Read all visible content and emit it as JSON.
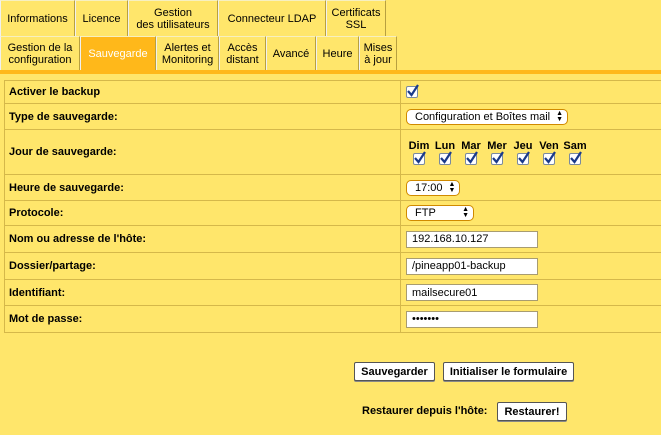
{
  "tabs_row1": [
    {
      "name": "tab-informations",
      "label": "Informations",
      "width": 75
    },
    {
      "name": "tab-licence",
      "label": "Licence",
      "width": 53
    },
    {
      "name": "tab-gestion-utilisateurs",
      "label": "Gestion\ndes utilisateurs",
      "width": 90
    },
    {
      "name": "tab-connecteur-ldap",
      "label": "Connecteur LDAP",
      "width": 108
    },
    {
      "name": "tab-certificats-ssl",
      "label": "Certificats\nSSL",
      "width": 60
    }
  ],
  "tabs_row2": [
    {
      "name": "tab-gestion-configuration",
      "label": "Gestion de la\nconfiguration",
      "width": 80
    },
    {
      "name": "tab-sauvegarde",
      "label": "Sauvegarde",
      "width": 76,
      "active": true
    },
    {
      "name": "tab-alertes-monitoring",
      "label": "Alertes et\nMonitoring",
      "width": 63
    },
    {
      "name": "tab-acces-distant",
      "label": "Accès\ndistant",
      "width": 47
    },
    {
      "name": "tab-avance",
      "label": "Avancé",
      "width": 50
    },
    {
      "name": "tab-heure",
      "label": "Heure",
      "width": 43
    },
    {
      "name": "tab-mises-a-jour",
      "label": "Mises\nà jour",
      "width": 38
    }
  ],
  "form": {
    "enable_backup_label": "Activer le backup",
    "backup_type_label": "Type de sauvegarde:",
    "backup_type_value": "Configuration et Boîtes mail",
    "backup_day_label": "Jour de sauvegarde:",
    "days": [
      "Dim",
      "Lun",
      "Mar",
      "Mer",
      "Jeu",
      "Ven",
      "Sam"
    ],
    "backup_time_label": "Heure de sauvegarde:",
    "backup_time_value": "17:00",
    "protocol_label": "Protocole:",
    "protocol_value": "FTP",
    "host_label": "Nom ou adresse de l'hôte:",
    "host_value": "192.168.10.127",
    "folder_label": "Dossier/partage:",
    "folder_value": "/pineapp01-backup",
    "username_label": "Identifiant:",
    "username_value": "mailsecure01",
    "password_label": "Mot de passe:",
    "password_value": "•••••••"
  },
  "buttons": {
    "save": "Sauvegarder",
    "reset": "Initialiser le formulaire",
    "restore_label": "Restaurer depuis l'hôte:",
    "restore": "Restaurer!"
  },
  "colors": {
    "background": "#ffe66b",
    "active_tab": "#ffb81a",
    "border": "#d5b84a"
  }
}
